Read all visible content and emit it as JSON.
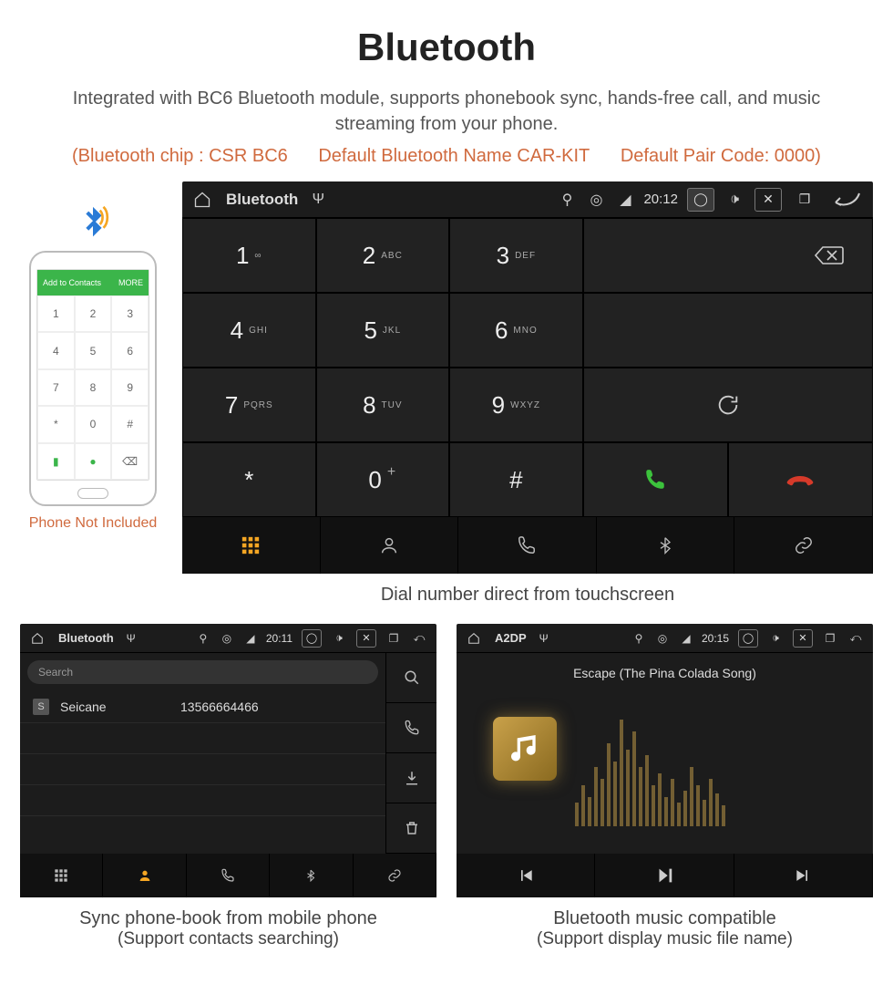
{
  "title": "Bluetooth",
  "description": "Integrated with BC6 Bluetooth module, supports phonebook sync, hands-free call, and music streaming from your phone.",
  "chip": {
    "a": "(Bluetooth chip : CSR BC6",
    "b": "Default Bluetooth Name CAR-KIT",
    "c": "Default Pair Code: 0000)"
  },
  "phone": {
    "top_label": "Add to Contacts",
    "top_right": "MORE",
    "caption": "Phone Not Included"
  },
  "dialer": {
    "status": {
      "title": "Bluetooth",
      "time": "20:12"
    },
    "keys": [
      {
        "num": "1",
        "sub": "∞"
      },
      {
        "num": "2",
        "sub": "ABC"
      },
      {
        "num": "3",
        "sub": "DEF"
      },
      {
        "num": "4",
        "sub": "GHI"
      },
      {
        "num": "5",
        "sub": "JKL"
      },
      {
        "num": "6",
        "sub": "MNO"
      },
      {
        "num": "7",
        "sub": "PQRS"
      },
      {
        "num": "8",
        "sub": "TUV"
      },
      {
        "num": "9",
        "sub": "WXYZ"
      },
      {
        "num": "*",
        "sub": ""
      },
      {
        "num": "0",
        "sub": "+"
      },
      {
        "num": "#",
        "sub": ""
      }
    ],
    "caption": "Dial number direct from touchscreen"
  },
  "phonebook": {
    "status": {
      "title": "Bluetooth",
      "time": "20:11"
    },
    "search_placeholder": "Search",
    "contact": {
      "badge": "S",
      "name": "Seicane",
      "number": "13566664466"
    },
    "caption1": "Sync phone-book from mobile phone",
    "caption2": "(Support contacts searching)"
  },
  "music": {
    "status": {
      "title": "A2DP",
      "time": "20:15"
    },
    "song": "Escape (The Pina Colada Song)",
    "caption1": "Bluetooth music compatible",
    "caption2": "(Support display music file name)"
  }
}
